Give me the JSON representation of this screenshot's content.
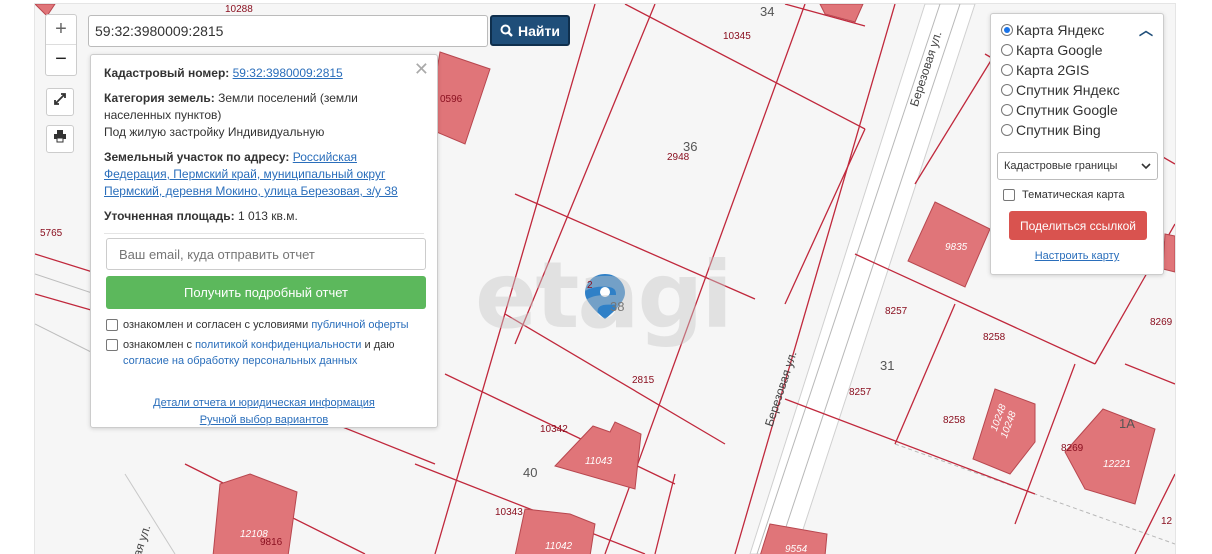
{
  "map": {
    "parcel_numbers": [
      "10288",
      "34",
      "10345",
      "0596",
      "36",
      "2948",
      "5765",
      "9835",
      "2",
      "38",
      "8257",
      "8258",
      "8269",
      "31",
      "2815",
      "8257",
      "8258",
      "10248",
      "10248",
      "1A",
      "8269",
      "12221",
      "10342",
      "11043",
      "40",
      "10343",
      "11042",
      "12108",
      "9816",
      "9554",
      "12"
    ],
    "street_name": "Березовая ул.",
    "street_name_short": "ая ул.",
    "watermark": "etagi"
  },
  "controls": {
    "zoom_in": "+",
    "zoom_out": "−",
    "fullscreen_icon": "expand-arrows-icon",
    "print_icon": "printer-icon"
  },
  "search": {
    "value": "59:32:3980009:2815",
    "button_label": "Найти"
  },
  "info": {
    "cadastral_label": "Кадастровый номер:",
    "cadastral_value": "59:32:3980009:2815",
    "category_label": "Категория земель:",
    "category_value": "Земли поселений (земли населенных пунктов)",
    "usage": "Под жилую застройку Индивидуальную",
    "address_label": "Земельный участок по адресу:",
    "address_value": "Российская Федерация, Пермский край, муниципальный округ Пермский, деревня Мокино, улица Березовая, з/у 38",
    "area_label": "Уточненная площадь:",
    "area_value": "1 013 кв.м.",
    "email_placeholder": "Ваш email, куда отправить отчет",
    "report_button": "Получить подробный отчет",
    "agree1_prefix": "ознакомлен и согласен с условиями",
    "agree1_link": "публичной оферты",
    "agree2_prefix": "ознакомлен с",
    "agree2_link": "политикой конфиденциальности",
    "agree2_mid": "и даю",
    "agree2_link2": "согласие на обработку персональных данных",
    "details_link": "Детали отчета и юридическая информация",
    "manual_link": "Ручной выбор вариантов"
  },
  "layers": {
    "options": [
      "Карта Яндекс",
      "Карта Google",
      "Карта 2GIS",
      "Спутник Яндекс",
      "Спутник Google",
      "Спутник Bing"
    ],
    "selected_index": 0,
    "select_value": "Кадастровые границы",
    "thematic_label": "Тематическая карта",
    "share_button": "Поделиться ссылкой",
    "setup_link": "Настроить карту"
  },
  "colors": {
    "parcel_line": "#c0283c",
    "building_fill": "#e07579",
    "marker": "#2f80c7",
    "search_button": "#1f4e79",
    "report_button": "#5cb85c",
    "share_button": "#d9534f"
  }
}
